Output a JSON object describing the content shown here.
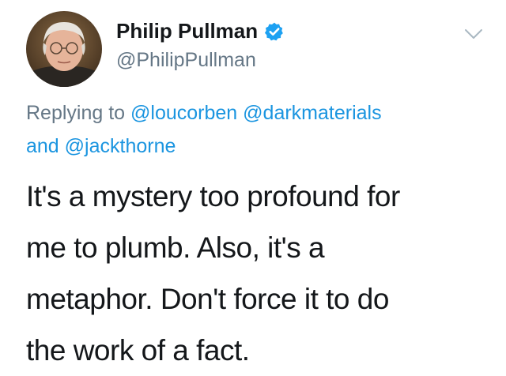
{
  "tweet": {
    "author": {
      "display_name": "Philip Pullman",
      "handle": "@PhilipPullman",
      "verified": true,
      "avatar_icon": "author-avatar",
      "verified_icon": "verified-badge-icon",
      "menu_icon": "chevron-down-icon"
    },
    "reply_context": {
      "prefix": "Replying to",
      "mentions": [
        "@loucorben",
        "@darkmaterials",
        "@jackthorne"
      ],
      "conjunction": "and"
    },
    "text_lines": [
      "It's a mystery too profound for",
      "me to plumb. Also, it's a",
      "metaphor. Don't force it to do",
      "the work of a fact."
    ]
  },
  "colors": {
    "link": "#1b95e0",
    "secondary_text": "#657786",
    "primary_text": "#14171a",
    "verified_blue": "#1da1f2"
  }
}
